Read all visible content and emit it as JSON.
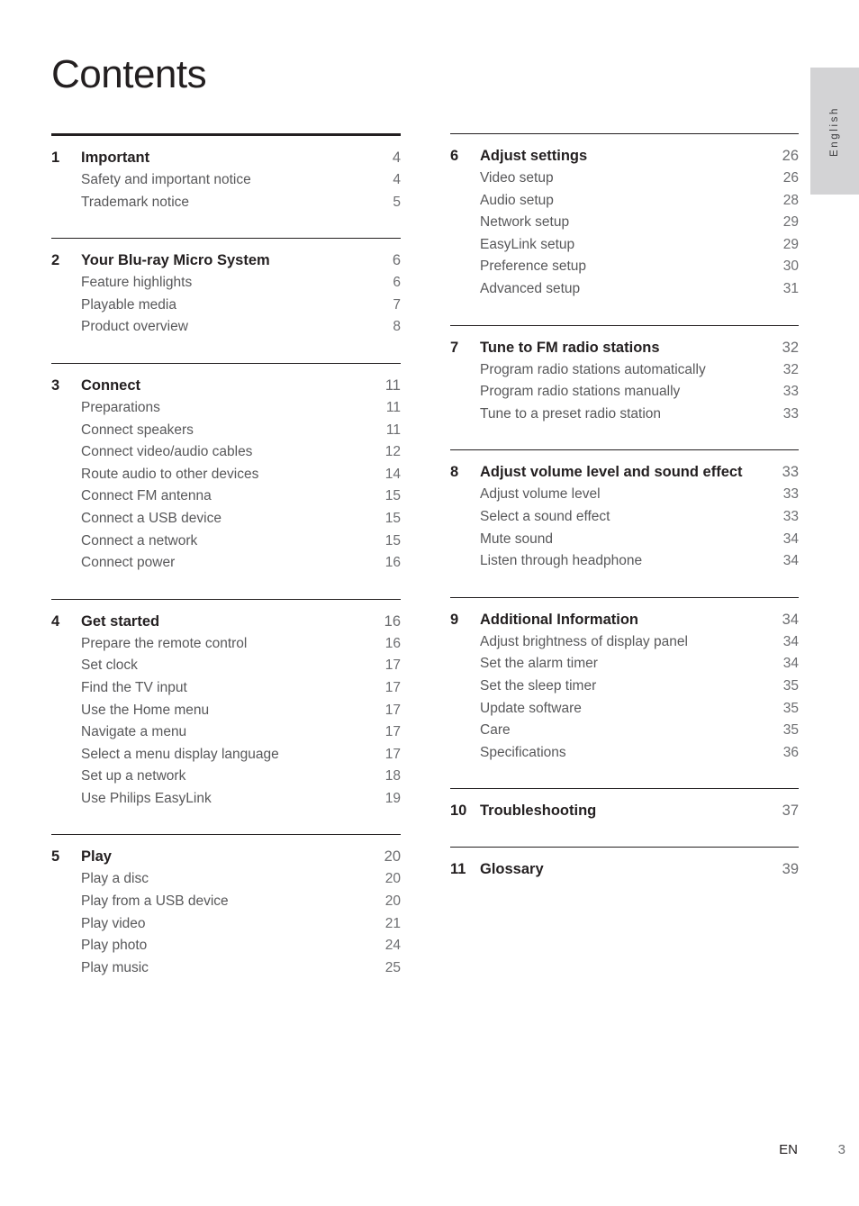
{
  "page_title": "Contents",
  "language_tab": "English",
  "footer": {
    "locale": "EN",
    "page_number": "3"
  },
  "columns": [
    {
      "side": "left",
      "sections": [
        {
          "rule": "thick",
          "number": "1",
          "title": "Important",
          "page": "4",
          "entries": [
            {
              "label": "Safety and important notice",
              "page": "4"
            },
            {
              "label": "Trademark notice",
              "page": "5"
            }
          ]
        },
        {
          "rule": "thin",
          "number": "2",
          "title": "Your Blu-ray Micro System",
          "page": "6",
          "entries": [
            {
              "label": "Feature highlights",
              "page": "6"
            },
            {
              "label": "Playable media",
              "page": "7"
            },
            {
              "label": "Product overview",
              "page": "8"
            }
          ]
        },
        {
          "rule": "thin",
          "number": "3",
          "title": "Connect",
          "page": "11",
          "entries": [
            {
              "label": "Preparations",
              "page": "11"
            },
            {
              "label": "Connect speakers",
              "page": "11"
            },
            {
              "label": "Connect video/audio cables",
              "page": "12"
            },
            {
              "label": "Route audio to other devices",
              "page": "14"
            },
            {
              "label": "Connect FM antenna",
              "page": "15"
            },
            {
              "label": "Connect a USB device",
              "page": "15"
            },
            {
              "label": "Connect a network",
              "page": "15"
            },
            {
              "label": "Connect power",
              "page": "16"
            }
          ]
        },
        {
          "rule": "thin",
          "number": "4",
          "title": "Get started",
          "page": "16",
          "entries": [
            {
              "label": "Prepare the remote control",
              "page": "16"
            },
            {
              "label": "Set clock",
              "page": "17"
            },
            {
              "label": "Find the TV input",
              "page": "17"
            },
            {
              "label": "Use the Home menu",
              "page": "17"
            },
            {
              "label": "Navigate a menu",
              "page": "17"
            },
            {
              "label": "Select a menu display language",
              "page": "17"
            },
            {
              "label": "Set up a network",
              "page": "18"
            },
            {
              "label": "Use Philips EasyLink",
              "page": "19"
            }
          ]
        },
        {
          "rule": "thin",
          "number": "5",
          "title": "Play",
          "page": "20",
          "entries": [
            {
              "label": "Play a disc",
              "page": "20"
            },
            {
              "label": "Play from a USB device",
              "page": "20"
            },
            {
              "label": "Play video",
              "page": "21"
            },
            {
              "label": "Play photo",
              "page": "24"
            },
            {
              "label": "Play music",
              "page": "25"
            }
          ]
        }
      ]
    },
    {
      "side": "right",
      "sections": [
        {
          "rule": "thin",
          "number": "6",
          "title": "Adjust settings",
          "page": "26",
          "entries": [
            {
              "label": "Video setup",
              "page": "26"
            },
            {
              "label": "Audio setup",
              "page": "28"
            },
            {
              "label": "Network setup",
              "page": "29"
            },
            {
              "label": "EasyLink setup",
              "page": "29"
            },
            {
              "label": "Preference setup",
              "page": "30"
            },
            {
              "label": "Advanced setup",
              "page": "31"
            }
          ]
        },
        {
          "rule": "thin",
          "number": "7",
          "title": "Tune to FM radio stations",
          "page": "32",
          "entries": [
            {
              "label": "Program radio stations automatically",
              "page": "32"
            },
            {
              "label": "Program radio stations manually",
              "page": "33"
            },
            {
              "label": "Tune to a preset radio station",
              "page": "33"
            }
          ]
        },
        {
          "rule": "thin",
          "number": "8",
          "title": "Adjust volume level and sound effect",
          "page": "33",
          "wraps": true,
          "entries": [
            {
              "label": "Adjust volume level",
              "page": "33"
            },
            {
              "label": "Select a sound effect",
              "page": "33"
            },
            {
              "label": "Mute sound",
              "page": "34"
            },
            {
              "label": "Listen through headphone",
              "page": "34"
            }
          ]
        },
        {
          "rule": "thin",
          "number": "9",
          "title": "Additional Information",
          "page": "34",
          "entries": [
            {
              "label": "Adjust brightness of display panel",
              "page": "34"
            },
            {
              "label": "Set the alarm timer",
              "page": "34"
            },
            {
              "label": "Set the sleep timer",
              "page": "35"
            },
            {
              "label": "Update software",
              "page": "35"
            },
            {
              "label": "Care",
              "page": "35"
            },
            {
              "label": "Specifications",
              "page": "36"
            }
          ]
        },
        {
          "rule": "thin",
          "number": "10",
          "title": "Troubleshooting",
          "page": "37",
          "entries": []
        },
        {
          "rule": "thin",
          "number": "11",
          "title": "Glossary",
          "page": "39",
          "entries": []
        }
      ]
    }
  ]
}
